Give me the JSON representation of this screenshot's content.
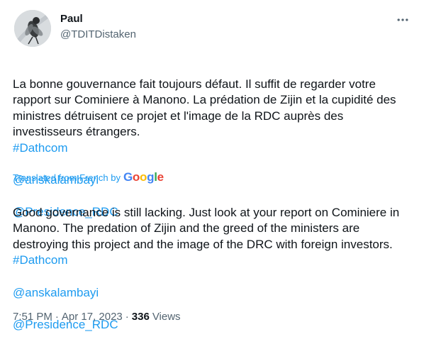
{
  "user": {
    "name": "Paul",
    "handle": "@TDITDistaken"
  },
  "tweet": {
    "original_text": "La bonne gouvernance fait toujours défaut. Il suffit de regarder votre rapport sur Cominiere à Manono. La prédation de Zijin et la cupidité des ministres détruisent ce projet et l'image de la RDC auprès des investisseurs étrangers.",
    "original_hashtag": "#Dathcom",
    "original_mention_1": "@anskalambayi",
    "original_mention_2": "@Presidence_RDC",
    "translated_from": "Translated from French by",
    "google_letters": [
      "G",
      "o",
      "o",
      "g",
      "l",
      "e"
    ],
    "translated_text": "Good governance is still lacking. Just look at your report on Cominiere in Manono. The predation of Zijin and the greed of the ministers are destroying this project and the image of the DRC with foreign investors.",
    "translated_hashtag": "#Dathcom",
    "translated_mention_1": "@anskalambayi",
    "translated_mention_2": "@Presidence_RDC"
  },
  "meta": {
    "time": "7:51 PM",
    "separator": "·",
    "date": "Apr 17, 2023",
    "views_count": "336",
    "views_label": "Views"
  },
  "colors": {
    "link": "#1d9bf0",
    "secondary_text": "#536471",
    "google": [
      "#4285F4",
      "#EA4335",
      "#FBBC05",
      "#4285F4",
      "#34A853",
      "#EA4335"
    ]
  },
  "icons": {
    "more": "more-horizontal-icon",
    "avatar": "insect-on-leaf-photo"
  }
}
